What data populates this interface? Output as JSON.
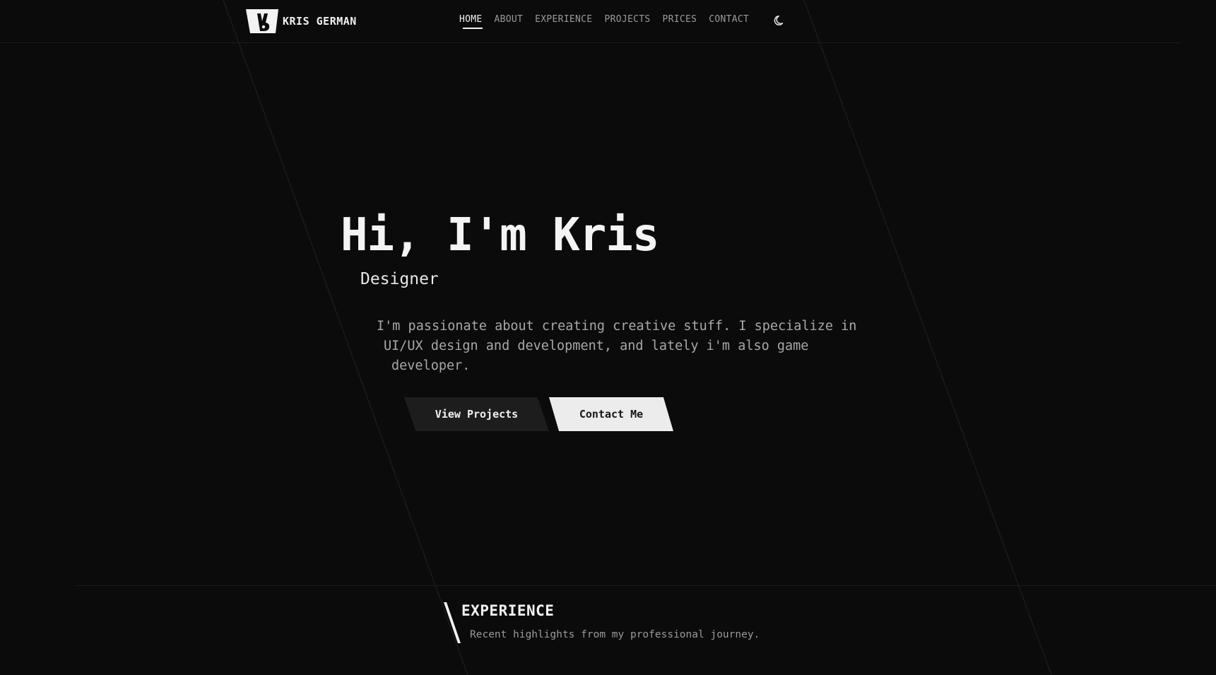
{
  "header": {
    "brand": {
      "name": "KRIS GERMAN",
      "logo_icon": "rabbit-logo-icon"
    },
    "nav": {
      "items": [
        {
          "label": "HOME",
          "active": true
        },
        {
          "label": "ABOUT",
          "active": false
        },
        {
          "label": "EXPERIENCE",
          "active": false
        },
        {
          "label": "PROJECTS",
          "active": false
        },
        {
          "label": "PRICES",
          "active": false
        },
        {
          "label": "CONTACT",
          "active": false
        }
      ]
    },
    "theme_toggle_icon": "moon-icon"
  },
  "hero": {
    "title": "Hi, I'm Kris",
    "role": "Designer",
    "description_lines": [
      "I'm passionate about creating creative stuff. I specialize in",
      "UI/UX design and development, and lately i'm also game",
      "developer."
    ],
    "buttons": {
      "primary": "View Projects",
      "secondary": "Contact Me"
    }
  },
  "experience": {
    "title": "EXPERIENCE",
    "subtitle": "Recent highlights from my professional journey."
  },
  "colors": {
    "background": "#0b0b0b",
    "text": "#f2f2f2",
    "muted": "#9a9a9a",
    "button_dark": "#1d1d1d",
    "button_light": "#ececec"
  }
}
